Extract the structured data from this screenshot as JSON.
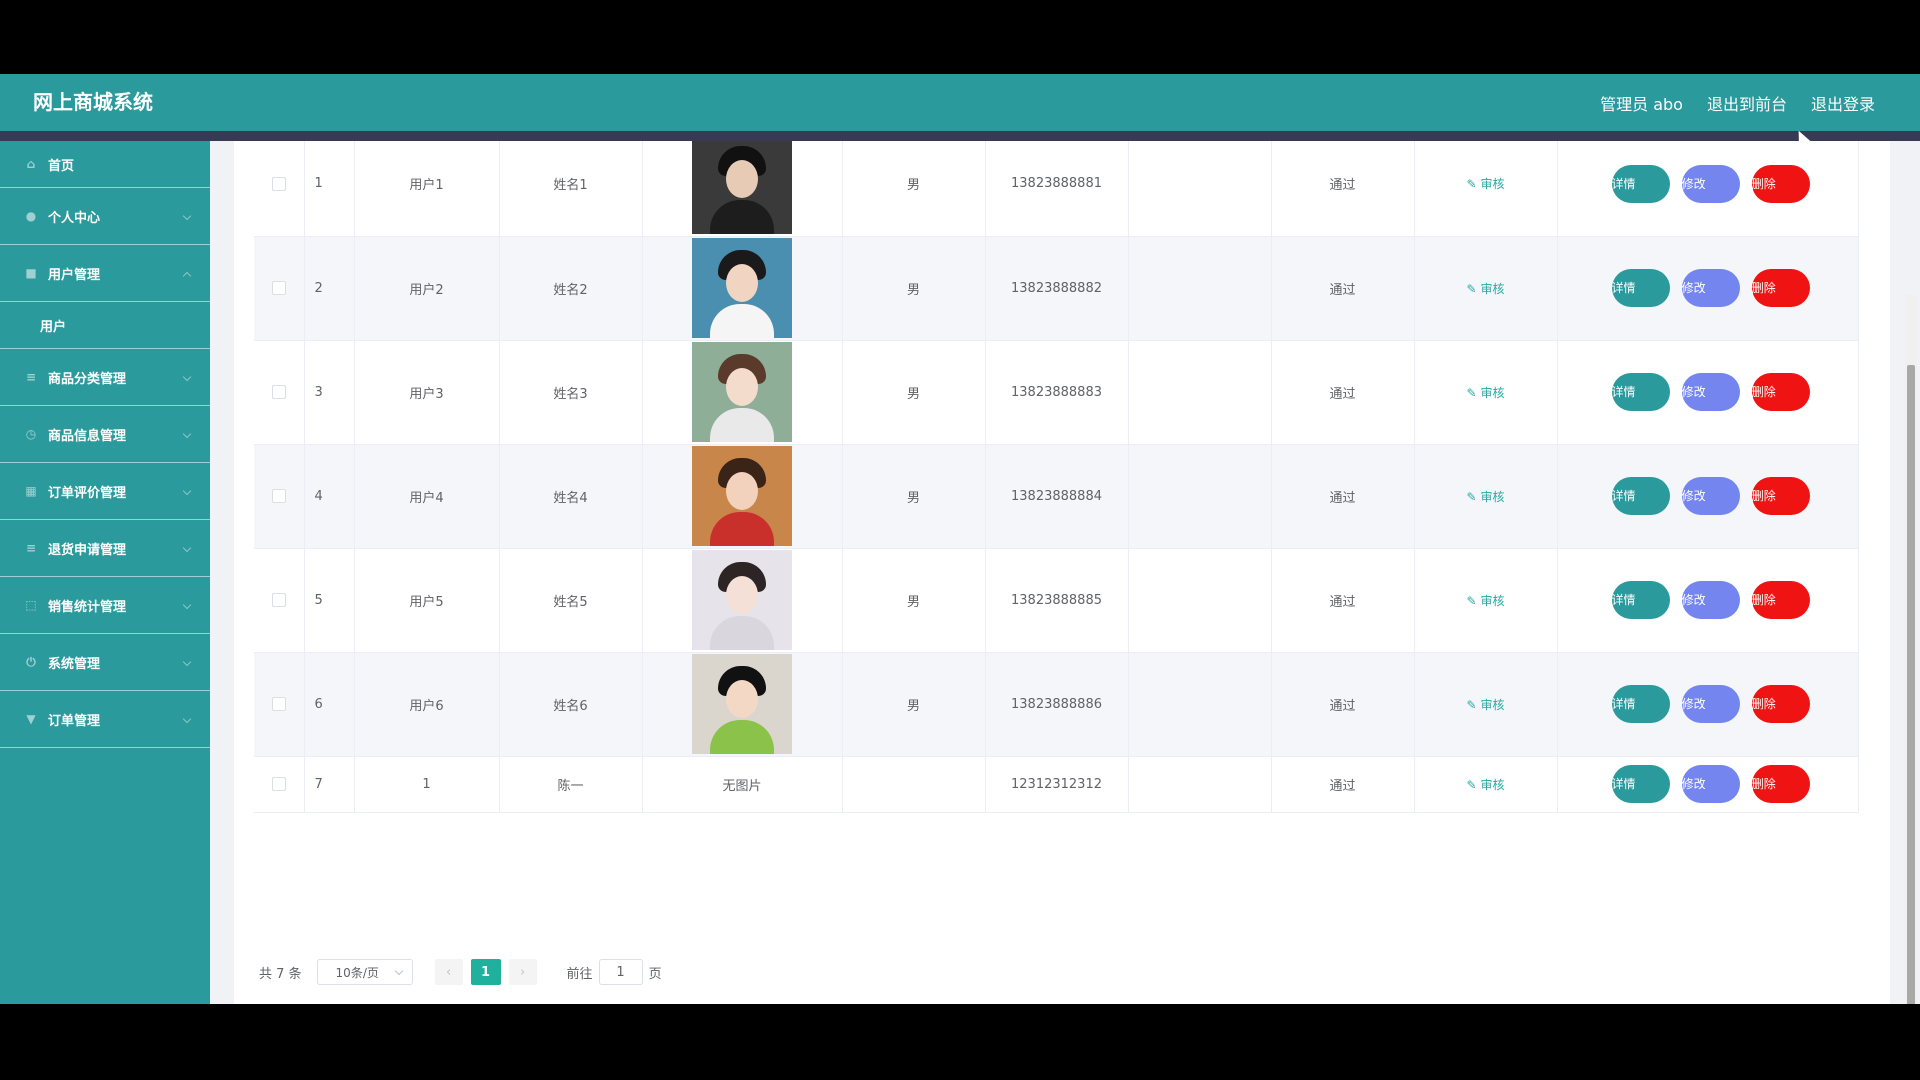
{
  "header": {
    "title": "网上商城系统",
    "admin_label": "管理员 abo",
    "to_front": "退出到前台",
    "logout": "退出登录"
  },
  "sidebar": {
    "items": [
      {
        "label": "首页",
        "icon": "home-icon"
      },
      {
        "label": "个人中心",
        "icon": "user-icon"
      },
      {
        "label": "用户管理",
        "icon": "users-icon",
        "expanded": true,
        "sub": [
          "用户"
        ]
      },
      {
        "label": "商品分类管理",
        "icon": "list-icon"
      },
      {
        "label": "商品信息管理",
        "icon": "clock-icon"
      },
      {
        "label": "订单评价管理",
        "icon": "grid-icon"
      },
      {
        "label": "退货申请管理",
        "icon": "list-icon"
      },
      {
        "label": "销售统计管理",
        "icon": "chart-icon"
      },
      {
        "label": "系统管理",
        "icon": "power-icon"
      },
      {
        "label": "订单管理",
        "icon": "cart-icon"
      }
    ]
  },
  "table": {
    "rows": [
      {
        "index": "1",
        "account": "用户1",
        "name": "姓名1",
        "photo": "avatar",
        "gender": "男",
        "phone": "13823888881",
        "status": "通过",
        "audit": "审核"
      },
      {
        "index": "2",
        "account": "用户2",
        "name": "姓名2",
        "photo": "avatar",
        "gender": "男",
        "phone": "13823888882",
        "status": "通过",
        "audit": "审核"
      },
      {
        "index": "3",
        "account": "用户3",
        "name": "姓名3",
        "photo": "avatar",
        "gender": "男",
        "phone": "13823888883",
        "status": "通过",
        "audit": "审核"
      },
      {
        "index": "4",
        "account": "用户4",
        "name": "姓名4",
        "photo": "avatar",
        "gender": "男",
        "phone": "13823888884",
        "status": "通过",
        "audit": "审核"
      },
      {
        "index": "5",
        "account": "用户5",
        "name": "姓名5",
        "photo": "avatar",
        "gender": "男",
        "phone": "13823888885",
        "status": "通过",
        "audit": "审核"
      },
      {
        "index": "6",
        "account": "用户6",
        "name": "姓名6",
        "photo": "avatar",
        "gender": "男",
        "phone": "13823888886",
        "status": "通过",
        "audit": "审核"
      },
      {
        "index": "7",
        "account": "1",
        "name": "陈一",
        "photo": "无图片",
        "gender": "",
        "phone": "12312312312",
        "status": "通过",
        "audit": "审核"
      }
    ],
    "actions": {
      "detail": "详情",
      "edit": "修改",
      "delete": "删除"
    }
  },
  "pager": {
    "total": "共 7 条",
    "page_size": "10条/页",
    "prev": "‹",
    "current": "1",
    "next": "›",
    "goto_label": "前往",
    "goto_value": "1",
    "page_unit": "页"
  },
  "colors": {
    "brand": "#2a9a9c",
    "detail_button": "#2a9a9c",
    "edit_button": "#7485ef",
    "delete_button": "#ef1313",
    "active_page": "#1fb09e"
  }
}
